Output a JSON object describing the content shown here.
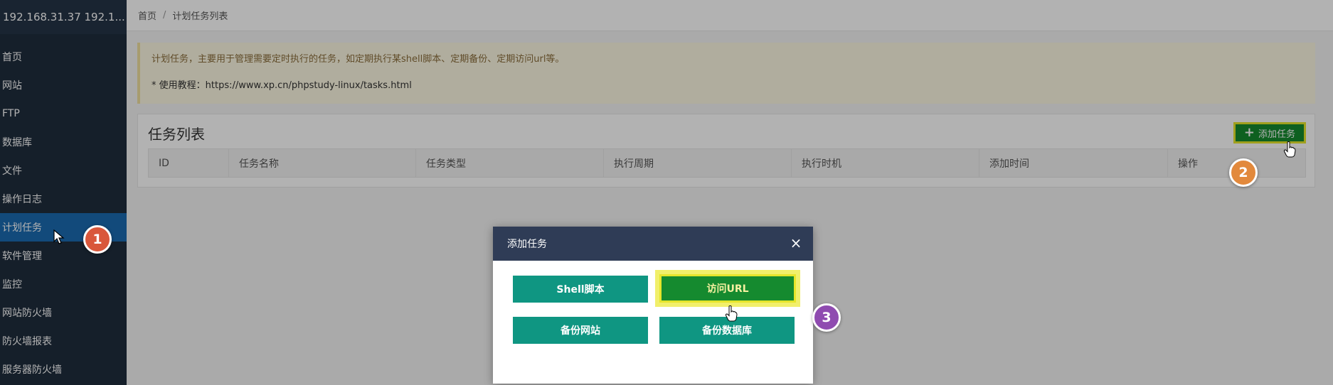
{
  "sidebar": {
    "server": "192.168.31.37 192.1...",
    "items": [
      {
        "label": "首页"
      },
      {
        "label": "网站"
      },
      {
        "label": "FTP"
      },
      {
        "label": "数据库"
      },
      {
        "label": "文件"
      },
      {
        "label": "操作日志"
      },
      {
        "label": "计划任务",
        "active": true
      },
      {
        "label": "软件管理"
      },
      {
        "label": "监控"
      },
      {
        "label": "网站防火墙"
      },
      {
        "label": "防火墙报表"
      },
      {
        "label": "服务器防火墙"
      }
    ]
  },
  "breadcrumb": {
    "home": "首页",
    "separator": "/",
    "current": "计划任务列表"
  },
  "notice": {
    "line1": "计划任务，主要用于管理需要定时执行的任务，如定期执行某shell脚本、定期备份、定期访问url等。",
    "line2": "* 使用教程：https://www.xp.cn/phpstudy-linux/tasks.html"
  },
  "panel": {
    "title": "任务列表",
    "add_button": "添加任务",
    "columns": [
      "ID",
      "任务名称",
      "任务类型",
      "执行周期",
      "执行时机",
      "添加时间",
      "操作"
    ]
  },
  "dialog": {
    "title": "添加任务",
    "buttons": {
      "shell": "Shell脚本",
      "url": "访问URL",
      "site": "备份网站",
      "db": "备份数据库"
    }
  },
  "callouts": {
    "one": "1",
    "two": "2",
    "three": "3"
  },
  "colors": {
    "sidebar_bg": "#1f2d3d",
    "active_item": "#1a6ab0",
    "primary_green": "#158a2f",
    "teal": "#0f9682",
    "dialog_header": "#2f3c56",
    "highlight": "#e6e52c"
  }
}
